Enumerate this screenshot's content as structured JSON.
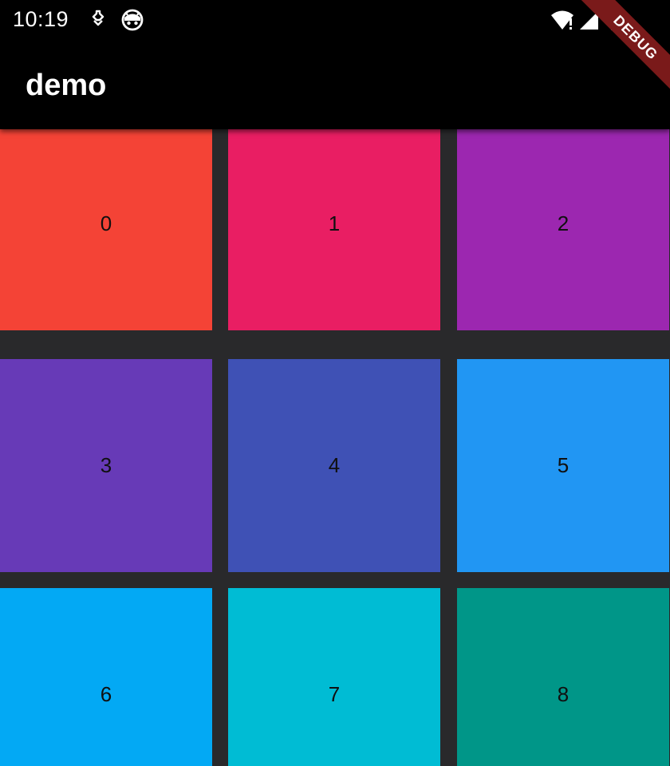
{
  "status_bar": {
    "time": "10:19",
    "icons": [
      "navigation-icon",
      "android-robot-icon",
      "wifi-alert-icon",
      "signal-icon",
      "battery-icon"
    ]
  },
  "app_bar": {
    "title": "demo"
  },
  "debug_banner": {
    "label": "DEBUG",
    "color": "#7a1a1a"
  },
  "grid": {
    "background": "#29292b",
    "tiles": [
      {
        "label": "0",
        "color": "#f44336"
      },
      {
        "label": "1",
        "color": "#e91e63"
      },
      {
        "label": "2",
        "color": "#9c27b0"
      },
      {
        "label": "3",
        "color": "#673ab7"
      },
      {
        "label": "4",
        "color": "#3f51b5"
      },
      {
        "label": "5",
        "color": "#2196f3"
      },
      {
        "label": "6",
        "color": "#03a9f4"
      },
      {
        "label": "7",
        "color": "#00bcd4"
      },
      {
        "label": "8",
        "color": "#009688"
      }
    ]
  }
}
